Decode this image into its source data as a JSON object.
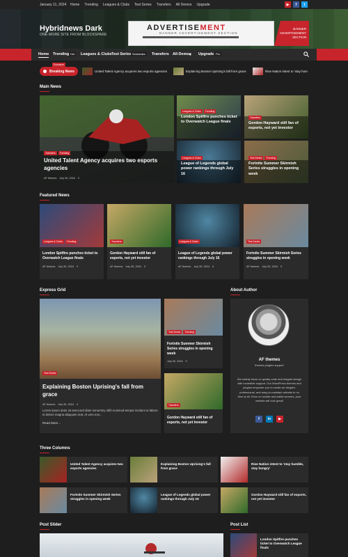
{
  "topbar": {
    "date": "January 11, 2024",
    "nav": [
      "Home",
      "Trending",
      "Leagues & Clubs",
      "Test Series",
      "Transfers",
      "All Demos",
      "Upgrade"
    ],
    "social_colors": [
      "#c8242c",
      "#3b5998",
      "#1da1f2"
    ]
  },
  "header": {
    "site_title": "Hybridnews Dark",
    "tagline": "ONE MORE SITE FROM BLOCKSPARE",
    "ad": {
      "title_main": "ADVERTISE",
      "title_accent": "MENT",
      "subtitle": "BANNER ADVERTISEMENT SECTION",
      "side_lines": [
        "BANNER",
        "ADVERTISEMENT",
        "SECTION"
      ]
    }
  },
  "nav": {
    "items": [
      "Home",
      "Trending",
      "Leagues & Clubs",
      "Test Series",
      "Transfers",
      "All Demos",
      "Upgrade"
    ],
    "badges": {
      "trending": "Hot",
      "test_series": "Schedules",
      "upgrade": "Pro"
    },
    "accent": "#c8242c"
  },
  "breaking": {
    "label": "Breaking News",
    "badge": "Exclusive",
    "items": [
      "United Talent Agency acquires two esports agencies",
      "Explaining Boston Uprising's fall from grace",
      "Rise Nation intent to 'stay hum"
    ]
  },
  "main_news": {
    "title": "Main News",
    "featured": {
      "tags": [
        "Transfers",
        "Trending"
      ],
      "title": "United Talent Agency acquires two esports agencies",
      "author": "AF themes",
      "date": "July 30, 2024",
      "comments": "0"
    },
    "side": [
      {
        "tags": [
          "Leagues & Clubs",
          "Trending"
        ],
        "title": "London Spitfire punches ticket to Overwatch League finals"
      },
      {
        "tags": [
          "Transfers"
        ],
        "title": "Gordon Hayward still fan of esports, not yet investor"
      },
      {
        "tags": [
          "Leagues & Clubs"
        ],
        "title": "League of Legends global power rankings through July 16"
      },
      {
        "tags": [
          "Test Series",
          "Trending"
        ],
        "title": "Fortnite Summer Skirmish Series struggles in opening week"
      }
    ]
  },
  "featured_news": {
    "title": "Featured News",
    "items": [
      {
        "tags": [
          "Leagues & Clubs",
          "Trending"
        ],
        "title": "London Spitfire punches ticket to Overwatch League finals",
        "author": "AF themes",
        "date": "July 30, 2024",
        "comments": "0"
      },
      {
        "tags": [
          "Transfers"
        ],
        "title": "Gordon Hayward still fan of esports, not yet investor",
        "author": "AF themes",
        "date": "July 30, 2024",
        "comments": "0"
      },
      {
        "tags": [
          "Leagues & Clubs"
        ],
        "title": "League of Legends global power rankings through July 16",
        "author": "AF themes",
        "date": "July 30, 2024",
        "comments": "0"
      },
      {
        "tags": [
          "Test Series"
        ],
        "title": "Fortnite Summer Skirmish Series struggles in opening week",
        "author": "AF themes",
        "date": "July 30, 2024",
        "comments": "0"
      }
    ]
  },
  "express_grid": {
    "title": "Express Grid",
    "main": {
      "tags": [
        "Test Series"
      ],
      "title": "Explaining Boston Uprising's fall from grace",
      "author": "AF themes",
      "date": "July 30, 2024",
      "comments": "0",
      "excerpt": "Lorem ipsum dolor sit amet,sed diam nonummy nibh euismod tempor incidunt ut labore et dolore magna aliquyam erat, At vero eos...",
      "read_more": "Read More..."
    },
    "side": [
      {
        "tags": [
          "Test Series",
          "Trending"
        ],
        "title": "Fortnite Summer Skirmish Series struggles in opening week",
        "date": "July 30, 2024",
        "comments": "0"
      },
      {
        "tags": [
          "Transfers"
        ],
        "title": "Gordon Hayward still fan of esports, not yet investor",
        "date": "July 30, 2024",
        "comments": "0"
      }
    ]
  },
  "about_author": {
    "title": "About Author",
    "name": "AF themes",
    "role": "themes plugins support",
    "bio": "We mainly focus on quality code and elegant design with incredible support. Our WordPress themes and plugins empower you to create an elegant, professional, and easy-to-maintain website in no time at all. Even on mobile and tablet screens, your website will look great!",
    "social_colors": [
      "#3b5998",
      "#0077b5",
      "#c8242c"
    ]
  },
  "three_columns": {
    "title": "Three Columns",
    "items": [
      "United Talent Agency acquires two esports agencies",
      "Explaining Boston Uprising's fall from grace",
      "Rise Nation intent to 'stay humble, stay hungry'",
      "Fortnite Summer Skirmish Series struggles in opening week",
      "League of Legends global power rankings through July 16",
      "Gordon Hayward still fan of esports, not yet investor"
    ]
  },
  "post_slider": {
    "title": "Post Slider"
  },
  "post_list": {
    "title": "Post List",
    "items": [
      "London Spitfire punches ticket to Overwatch League finals"
    ]
  }
}
